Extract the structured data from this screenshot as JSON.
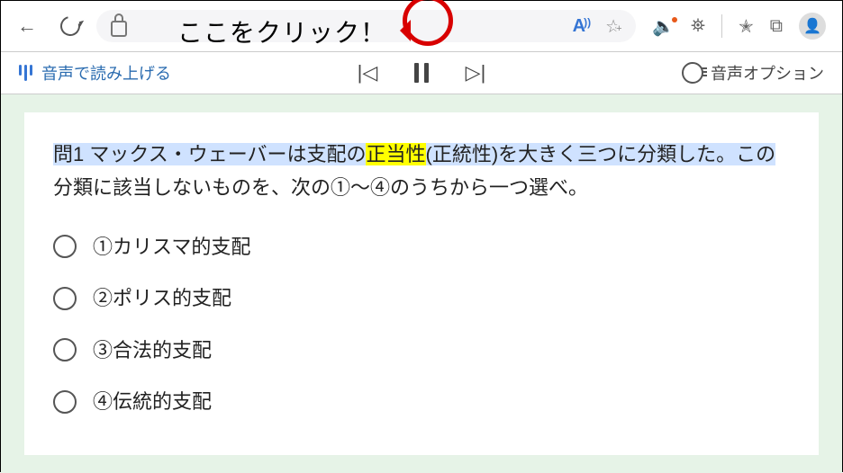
{
  "annotation": {
    "callout_text": "ここをクリック！"
  },
  "reader": {
    "read_aloud_label": "音声で読み上げる",
    "voice_options_label": "音声オプション"
  },
  "document": {
    "q_seg1": "問1 マックス・ウェーバーは支配の",
    "q_hl": "正当性",
    "q_seg2": "(正統性)を大きく三つに分類した。この",
    "q_line2": "分類に該当しないものを、次の①〜④のうちから一つ選べ。",
    "options": {
      "o1": "①カリスマ的支配",
      "o2": "②ポリス的支配",
      "o3": "③合法的支配",
      "o4": "④伝統的支配"
    }
  }
}
